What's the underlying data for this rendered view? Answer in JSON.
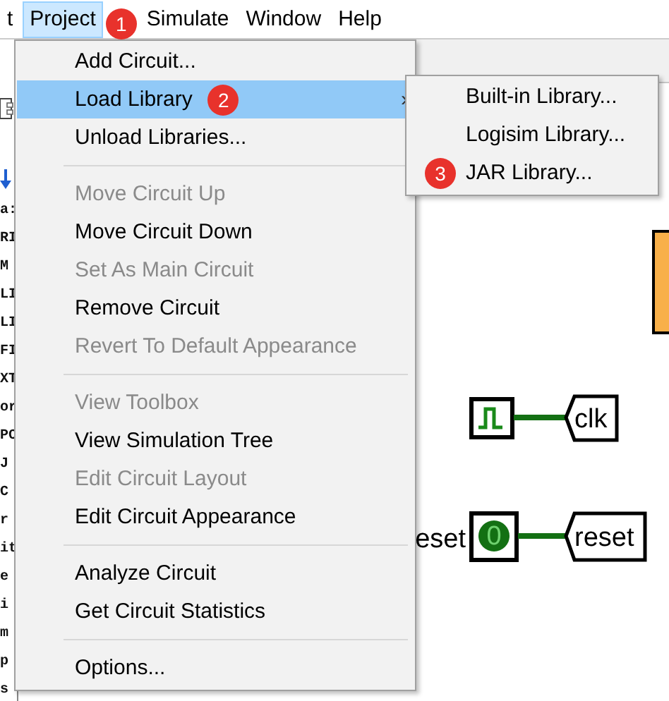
{
  "menubar": [
    {
      "label": "t",
      "selected": false
    },
    {
      "label": "Project",
      "selected": true,
      "badge": "1"
    },
    {
      "label": "Simulate",
      "selected": false
    },
    {
      "label": "Window",
      "selected": false
    },
    {
      "label": "Help",
      "selected": false
    }
  ],
  "sidebar": {
    "items": [
      "a:",
      "RI",
      "M",
      "LI",
      "LI",
      "FI",
      "XT",
      "or",
      "PC",
      "J",
      "C",
      "r",
      "it",
      "e",
      "i",
      "m",
      "p",
      "s"
    ]
  },
  "canvas": {
    "clock_label": "clk",
    "input_pin_label": "eset",
    "input_pin_value": "0",
    "tunnel_label": "reset"
  },
  "menu": {
    "items": [
      {
        "kind": "item",
        "label": "Add Circuit...",
        "disabled": false,
        "selected": false
      },
      {
        "kind": "item",
        "label": "Load Library",
        "disabled": false,
        "selected": true,
        "badge": "2",
        "arrow": "›"
      },
      {
        "kind": "item",
        "label": "Unload Libraries...",
        "disabled": false,
        "selected": false
      },
      {
        "kind": "separator"
      },
      {
        "kind": "item",
        "label": "Move Circuit Up",
        "disabled": true,
        "selected": false
      },
      {
        "kind": "item",
        "label": "Move Circuit Down",
        "disabled": false,
        "selected": false
      },
      {
        "kind": "item",
        "label": "Set As Main Circuit",
        "disabled": true,
        "selected": false
      },
      {
        "kind": "item",
        "label": "Remove Circuit",
        "disabled": false,
        "selected": false
      },
      {
        "kind": "item",
        "label": "Revert To Default Appearance",
        "disabled": true,
        "selected": false
      },
      {
        "kind": "separator"
      },
      {
        "kind": "item",
        "label": "View Toolbox",
        "disabled": true,
        "selected": false
      },
      {
        "kind": "item",
        "label": "View Simulation Tree",
        "disabled": false,
        "selected": false
      },
      {
        "kind": "item",
        "label": "Edit Circuit Layout",
        "disabled": true,
        "selected": false
      },
      {
        "kind": "item",
        "label": "Edit Circuit Appearance",
        "disabled": false,
        "selected": false
      },
      {
        "kind": "separator"
      },
      {
        "kind": "item",
        "label": "Analyze Circuit",
        "disabled": false,
        "selected": false
      },
      {
        "kind": "item",
        "label": "Get Circuit Statistics",
        "disabled": false,
        "selected": false
      },
      {
        "kind": "separator"
      },
      {
        "kind": "item",
        "label": "Options...",
        "disabled": false,
        "selected": false
      }
    ]
  },
  "submenu": {
    "items": [
      {
        "kind": "item",
        "label": "Built-in Library...",
        "disabled": false,
        "selected": false
      },
      {
        "kind": "item",
        "label": "Logisim Library...",
        "disabled": false,
        "selected": false
      },
      {
        "kind": "item",
        "label": "JAR Library...",
        "disabled": false,
        "selected": false,
        "badge": "3"
      }
    ]
  }
}
